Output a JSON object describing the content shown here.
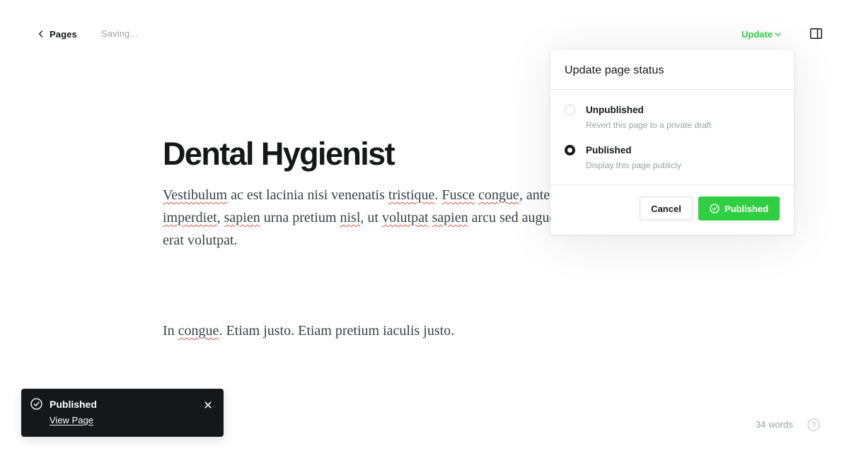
{
  "nav": {
    "back_label": "Pages",
    "status": "Saving...",
    "update_label": "Update"
  },
  "editor": {
    "title": "Dental Hygienist",
    "paragraph1": [
      {
        "text": "Vestibulum",
        "misspelled": true
      },
      {
        "text": " ac est lacinia nisi venenatis ",
        "misspelled": false
      },
      {
        "text": "tristique",
        "misspelled": true
      },
      {
        "text": ". ",
        "misspelled": false
      },
      {
        "text": "Fusce",
        "misspelled": true
      },
      {
        "text": " ",
        "misspelled": false
      },
      {
        "text": "congue",
        "misspelled": true
      },
      {
        "text": ", ante in ",
        "misspelled": false
      },
      {
        "text": "\n",
        "misspelled": false
      },
      {
        "text": "imperdiet",
        "misspelled": true
      },
      {
        "text": ", ",
        "misspelled": false
      },
      {
        "text": "sapien",
        "misspelled": true
      },
      {
        "text": " urna pretium ",
        "misspelled": false
      },
      {
        "text": "nisl",
        "misspelled": true
      },
      {
        "text": ", ut ",
        "misspelled": false
      },
      {
        "text": "volutpat",
        "misspelled": true
      },
      {
        "text": " ",
        "misspelled": false
      },
      {
        "text": "sapien",
        "misspelled": true
      },
      {
        "text": " arcu sed augue",
        "misspelled": false
      },
      {
        "text": "\n",
        "misspelled": false
      },
      {
        "text": "erat volutpat.",
        "misspelled": false
      }
    ],
    "paragraph2": [
      {
        "text": "In ",
        "misspelled": false
      },
      {
        "text": "congue",
        "misspelled": true
      },
      {
        "text": ". Etiam justo. Etiam pretium iaculis justo.",
        "misspelled": false
      }
    ]
  },
  "popover": {
    "title": "Update page status",
    "options": [
      {
        "label": "Unpublished",
        "description": "Revert this page to a private draft",
        "selected": false
      },
      {
        "label": "Published",
        "description": "Display this page publicly",
        "selected": true
      }
    ],
    "cancel_label": "Cancel",
    "confirm_label": "Published"
  },
  "toast": {
    "title": "Published",
    "link_label": "View Page"
  },
  "footer": {
    "word_count": "34 words"
  },
  "colors": {
    "accent_green": "#30cf43",
    "text_dark": "#15171a",
    "text_muted": "#9aa2a9",
    "spellcheck_red": "#e25440"
  },
  "icons": {
    "back": "chevron-left-icon",
    "update_dropdown": "chevron-down-icon",
    "settings": "sidebar-panel-icon",
    "confirm": "check-circle-icon",
    "toast": "check-circle-icon",
    "toast_close": "close-icon",
    "help": "question-circle-icon"
  }
}
